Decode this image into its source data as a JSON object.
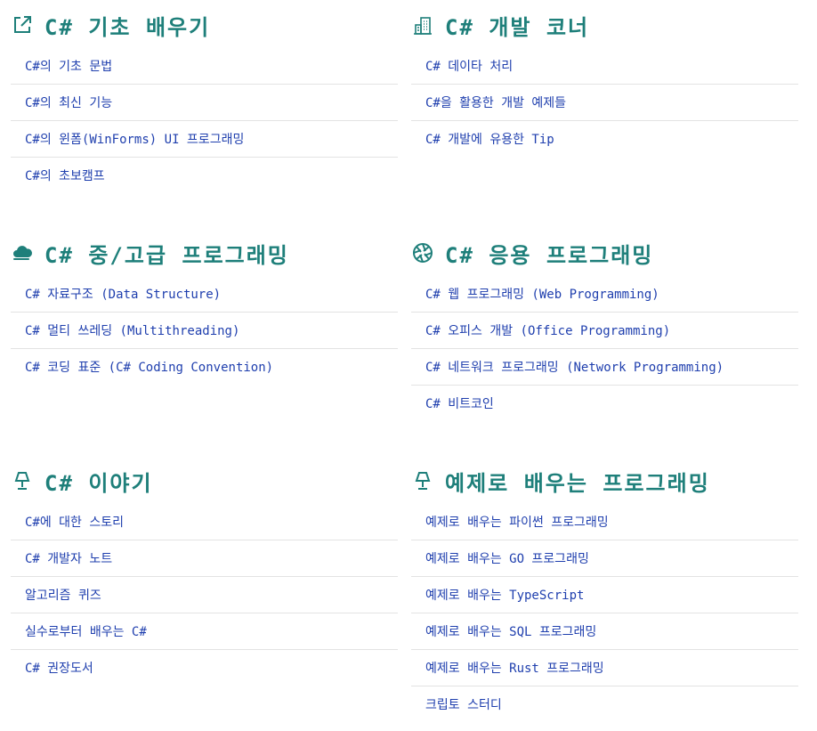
{
  "colors": {
    "title": "#1e7f7a",
    "link": "#1f3fae",
    "divider": "#e3e3e3"
  },
  "sections": [
    {
      "title": "C# 기초 배우기",
      "icon": "external-link-icon",
      "links": [
        "C#의 기초 문법",
        "C#의 최신 기능",
        "C#의 윈폼(WinForms) UI 프로그래밍",
        "C#의 초보캠프"
      ]
    },
    {
      "title": "C# 개발 코너",
      "icon": "building-icon",
      "links": [
        "C# 데이타 처리",
        "C#을 활용한 개발 예제들",
        "C# 개발에 유용한 Tip"
      ]
    },
    {
      "title": "C# 중/고급 프로그래밍",
      "icon": "cloud-icon",
      "links": [
        "C# 자료구조 (Data Structure)",
        "C# 멀티 쓰레딩 (Multithreading)",
        "C# 코딩 표준 (C# Coding Convention)"
      ]
    },
    {
      "title": "C# 응용 프로그래밍",
      "icon": "aperture-icon",
      "links": [
        "C# 웹 프로그래밍 (Web Programming)",
        "C# 오피스 개발 (Office Programming)",
        "C# 네트워크 프로그래밍 (Network Programming)",
        "C# 비트코인"
      ]
    },
    {
      "title": "C# 이야기",
      "icon": "lamp-icon",
      "links": [
        "C#에 대한 스토리",
        "C# 개발자 노트",
        "알고리즘 퀴즈",
        "실수로부터 배우는 C#",
        "C# 권장도서"
      ]
    },
    {
      "title": "예제로 배우는 프로그래밍",
      "icon": "lamp-icon",
      "links": [
        "예제로 배우는 파이썬 프로그래밍",
        "예제로 배우는 GO 프로그래밍",
        "예제로 배우는 TypeScript",
        "예제로 배우는 SQL 프로그래밍",
        "예제로 배우는 Rust 프로그래밍",
        "크립토 스터디"
      ]
    }
  ]
}
